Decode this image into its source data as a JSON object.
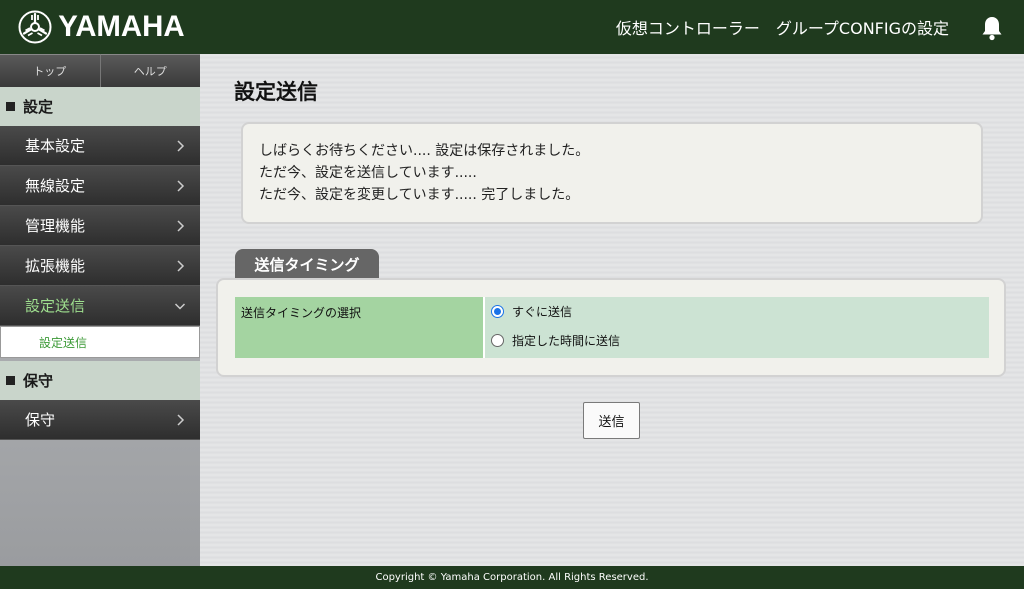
{
  "header": {
    "brand": "YAMAHA",
    "title": "仮想コントローラー　グループCONFIGの設定",
    "bell_icon": "bell-icon"
  },
  "sidebar": {
    "tabs": [
      "トップ",
      "ヘルプ"
    ],
    "sections": [
      {
        "label": "設定"
      },
      {
        "label": "保守"
      }
    ],
    "items": [
      {
        "label": "基本設定"
      },
      {
        "label": "無線設定"
      },
      {
        "label": "管理機能"
      },
      {
        "label": "拡張機能"
      },
      {
        "label": "設定送信"
      },
      {
        "label": "保守"
      }
    ],
    "sub_item": "設定送信"
  },
  "main": {
    "title": "設定送信",
    "messages": [
      "しばらくお待ちください.... 設定は保存されました。",
      "ただ今、設定を送信しています.....",
      "ただ今、設定を変更しています..... 完了しました。"
    ],
    "tab_label": "送信タイミング",
    "row_label": "送信タイミングの選択",
    "options": [
      {
        "label": "すぐに送信",
        "selected": true
      },
      {
        "label": "指定した時間に送信",
        "selected": false
      }
    ],
    "send_button": "送信"
  },
  "footer": {
    "copyright": "Copyright © Yamaha Corporation. All Rights Reserved."
  },
  "colors": {
    "header_bg": "#1f3a1e",
    "active_menu": "#9fe08f",
    "row_label_bg": "#a4d4a1",
    "row_value_bg": "#cce3d3"
  }
}
